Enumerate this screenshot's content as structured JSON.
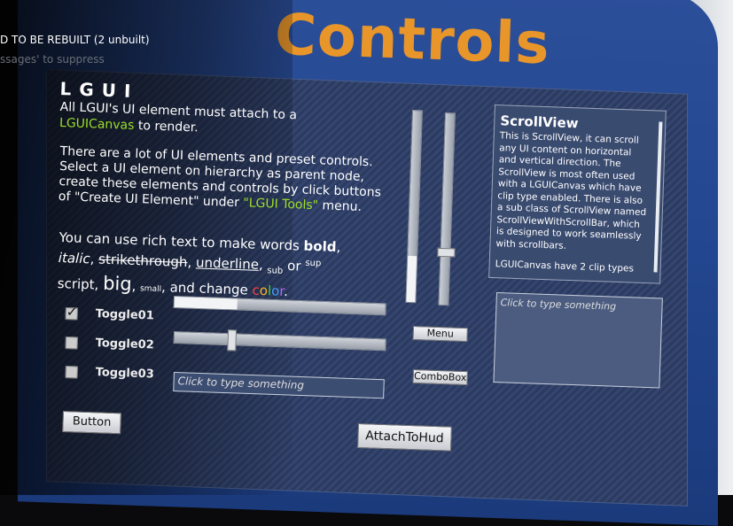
{
  "log": {
    "line1": "D TO BE REBUILT (2 unbuilt)",
    "line2": "ssages' to suppress"
  },
  "title": "Controls",
  "panel": {
    "header": "LGUI",
    "p1a": "All LGUI's UI element must attach to a",
    "p1b_green": "LGUICanvas",
    "p1c": " to render.",
    "p2a": "There are a lot of UI elements and preset controls. Select a UI element on hierarchy as parent node, create these elements and controls by click buttons of \"Create UI Element\" under ",
    "p2b_green": "\"LGUI Tools\"",
    "p2c": " menu.",
    "p3": {
      "a": "You can use rich text to make words ",
      "bold": "bold",
      "comma1": ",",
      "italic": "italic",
      "comma2": ", ",
      "strike": "strikethrough",
      "comma3": ", ",
      "underline": "underline",
      "comma4": ", ",
      "sub": "sub",
      "or": " or ",
      "sup": "sup",
      "script": "script, ",
      "big": "big",
      "comma5": ", ",
      "small": "small",
      "change": ", and change ",
      "color_letters": [
        "c",
        "o",
        "l",
        "o",
        "r"
      ],
      "end": "."
    }
  },
  "toggles": [
    {
      "label": "Toggle01",
      "checked": true
    },
    {
      "label": "Toggle02",
      "checked": false
    },
    {
      "label": "Toggle03",
      "checked": false
    }
  ],
  "sliders": {
    "h1": 0.3,
    "h2": 0.27,
    "v1": 0.24,
    "v2": 0.25
  },
  "input": {
    "placeholder": "Click to type something"
  },
  "buttons": {
    "button": "Button",
    "attach": "AttachToHud",
    "menu": "Menu",
    "combo": "ComboBox"
  },
  "scrollview": {
    "title": "ScrollView",
    "body": "This is ScrollView, it can scroll any UI content on horizontal and vertical direction. The ScrollView is most often used with a LGUICanvas which have clip type enabled. There is also a sub class of ScrollView named ScrollViewWithScrollBar, which is designed to work seamlessly with scrollbars.",
    "cut": "LGUICanvas have 2 clip types"
  },
  "textarea": {
    "placeholder": "Click to type something"
  },
  "colors": {
    "title": "#e8952a",
    "green": "#9cde28",
    "rainbow": [
      "#ff4040",
      "#ffb020",
      "#40d040",
      "#40a0ff",
      "#c060ff"
    ]
  }
}
